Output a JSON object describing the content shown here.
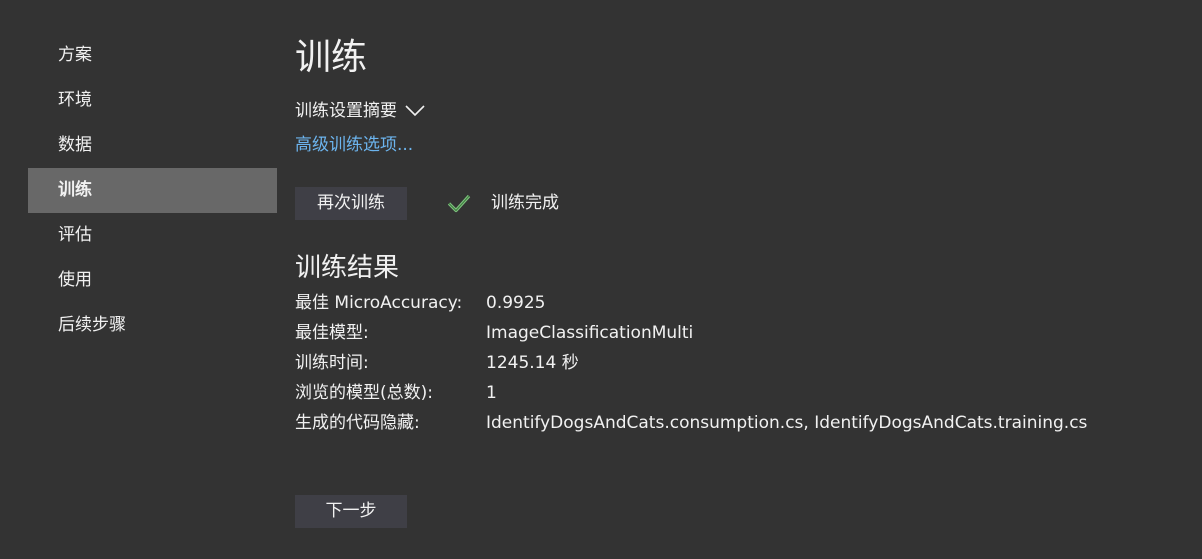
{
  "sidebar": {
    "items": [
      {
        "label": "方案"
      },
      {
        "label": "环境"
      },
      {
        "label": "数据"
      },
      {
        "label": "训练"
      },
      {
        "label": "评估"
      },
      {
        "label": "使用"
      },
      {
        "label": "后续步骤"
      }
    ],
    "active_index": 3
  },
  "main": {
    "title": "训练",
    "summary_label": "训练设置摘要",
    "advanced_link": "高级训练选项...",
    "retrain_button": "再次训练",
    "status_text": "训练完成",
    "results_title": "训练结果",
    "results": [
      {
        "label": "最佳 MicroAccuracy:",
        "value": "0.9925"
      },
      {
        "label": "最佳模型:",
        "value": "ImageClassificationMulti"
      },
      {
        "label": "训练时间:",
        "value": "1245.14 秒"
      },
      {
        "label": "浏览的模型(总数):",
        "value": "1"
      },
      {
        "label": "生成的代码隐藏:",
        "value": "IdentifyDogsAndCats.consumption.cs, IdentifyDogsAndCats.training.cs"
      }
    ],
    "next_button": "下一步"
  },
  "colors": {
    "background": "#333333",
    "active_nav": "#686868",
    "button": "#3f3f46",
    "link": "#6cb4ee",
    "success": "#7ec27e"
  },
  "icons": {
    "summary_toggle": "chevron-down-icon",
    "status": "check-icon"
  }
}
